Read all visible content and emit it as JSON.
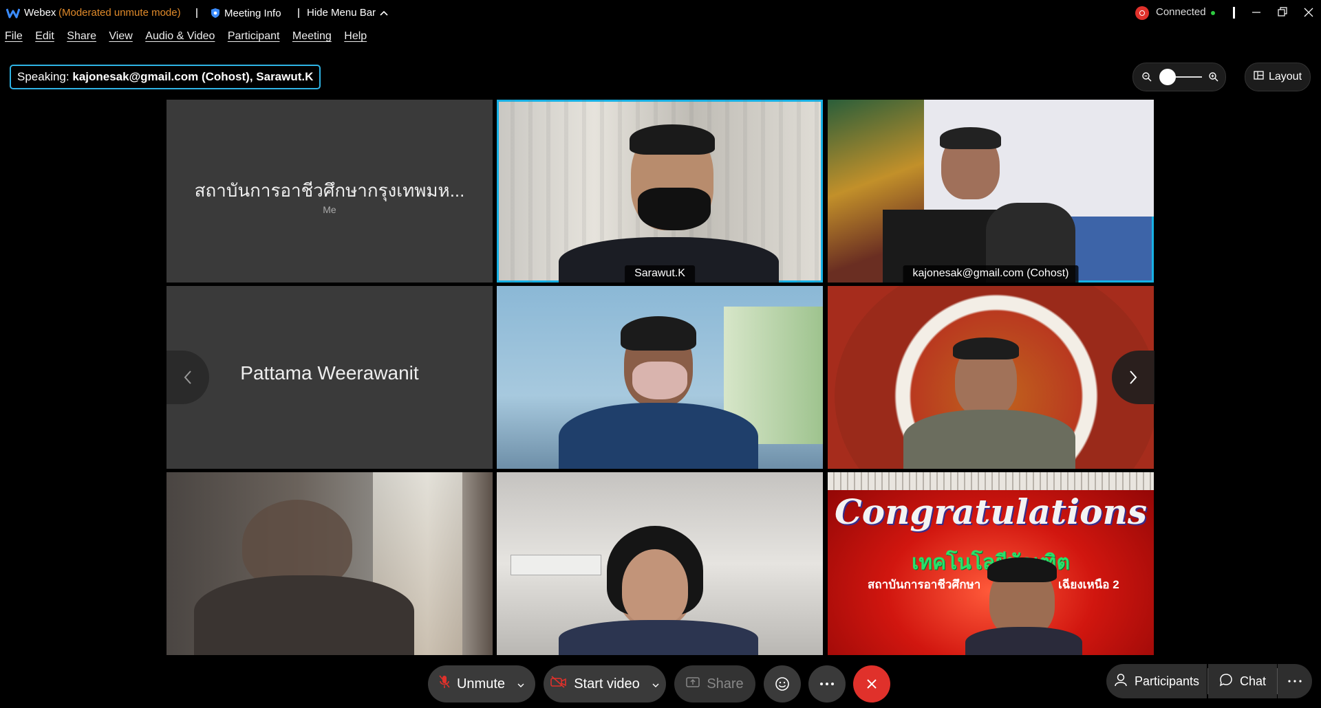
{
  "titlebar": {
    "app_name": "Webex",
    "mode": "(Moderated unmute mode)",
    "meeting_info": "Meeting Info",
    "hide_menu_bar": "Hide Menu Bar",
    "connection_status": "Connected",
    "status_color": "#2ecc40"
  },
  "menu": [
    "File",
    "Edit",
    "Share",
    "View",
    "Audio & Video",
    "Participant",
    "Meeting",
    "Help"
  ],
  "speaking": {
    "label": "Speaking:",
    "names": "kajonesak@gmail.com (Cohost), Sarawut.K"
  },
  "layout_button": "Layout",
  "zoom_level": 0.1,
  "tiles": [
    {
      "name": "สถาบันการอาชีวศึกษากรุงเทพมห...",
      "sub": "Me",
      "video": false
    },
    {
      "name": "Sarawut.K",
      "video": true,
      "active": true
    },
    {
      "name": "kajonesak@gmail.com  (Cohost)",
      "video": true,
      "active": true
    },
    {
      "name": "Pattama Weerawanit",
      "video": false
    },
    {
      "name": "",
      "video": true
    },
    {
      "name": "",
      "video": true
    },
    {
      "name": "",
      "video": true
    },
    {
      "name": "",
      "video": true
    },
    {
      "name": "",
      "video": true
    }
  ],
  "congrats": {
    "title": "Congratulations",
    "line1": "เทคโนโลยีบัณฑิต",
    "line2": "สถาบันการอาชีวศึกษา",
    "line2b": "เฉียงเหนือ 2"
  },
  "controls": {
    "unmute": "Unmute",
    "start_video": "Start video",
    "share": "Share",
    "participants": "Participants",
    "chat": "Chat"
  },
  "colors": {
    "accent": "#17b1e5",
    "end_call": "#e0312b",
    "mode_text": "#e08a2a"
  }
}
